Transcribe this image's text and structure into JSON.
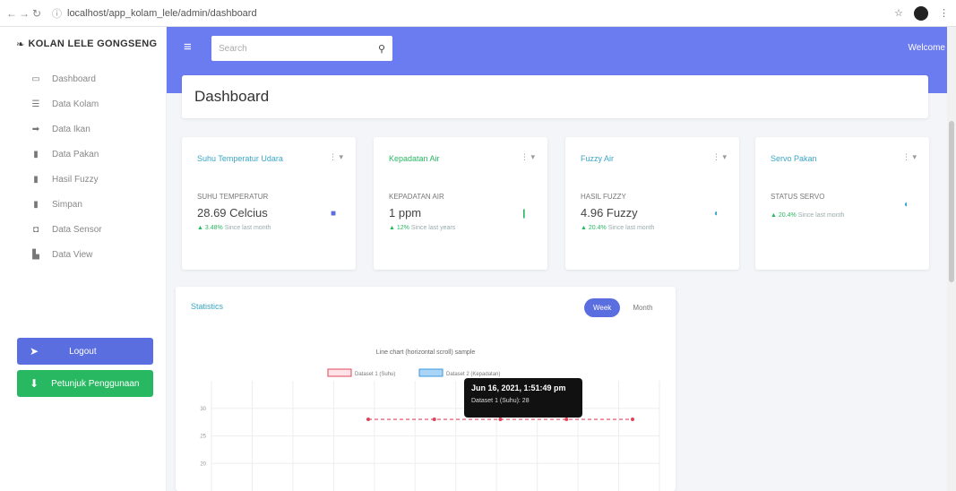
{
  "browser": {
    "url": "localhost/app_kolam_lele/admin/dashboard",
    "nav_back": "←",
    "nav_forward": "→",
    "nav_reload": "↻"
  },
  "sidebar": {
    "brand": "KOLAN LELE GONGSENG",
    "items": [
      {
        "label": "Dashboard",
        "icon": "monitor-icon",
        "glyph": "▭"
      },
      {
        "label": "Data Kolam",
        "icon": "table-icon",
        "glyph": "☰"
      },
      {
        "label": "Data Ikan",
        "icon": "fish-icon",
        "glyph": "➡"
      },
      {
        "label": "Data Pakan",
        "icon": "bag-icon",
        "glyph": "▮"
      },
      {
        "label": "Hasil Fuzzy",
        "icon": "document-icon",
        "glyph": "▮"
      },
      {
        "label": "Simpan",
        "icon": "save-icon",
        "glyph": "▮"
      },
      {
        "label": "Data Sensor",
        "icon": "sensor-icon",
        "glyph": "◘"
      },
      {
        "label": "Data View",
        "icon": "chart-icon",
        "glyph": "▙"
      }
    ],
    "logout_label": "Logout",
    "manual_label": "Petunjuk Penggunaan"
  },
  "topbar": {
    "search_placeholder": "Search",
    "welcome": "Welcome"
  },
  "page_title": "Dashboard",
  "cards": [
    {
      "title": "Suhu Temperatur Udara",
      "menu": "⋮ ▾",
      "label": "SUHU TEMPERATUR",
      "value": "28.69 Celcius",
      "trend_up": "▲ 3.48%",
      "trend_text": "Since last month",
      "icon_glyph": "■",
      "icon_color": "#5b6ee0",
      "icon": "temperature-icon"
    },
    {
      "title": "Kepadatan Air",
      "menu": "⋮ ▾",
      "label": "KEPADATAN AIR",
      "value": "1 ppm",
      "trend_up": "▲ 12%",
      "trend_text": "Since last years",
      "icon_glyph": "❙",
      "icon_color": "#28b862",
      "icon": "water-density-icon"
    },
    {
      "title": "Fuzzy Air",
      "menu": "⋮ ▾",
      "label": "HASIL FUZZY",
      "value": "4.96 Fuzzy",
      "trend_up": "▲ 20.4%",
      "trend_text": "Since last month",
      "icon_glyph": "◐",
      "icon_color": "#3aa6c7",
      "icon": "fuzzy-icon"
    },
    {
      "title": "Servo Pakan",
      "menu": "⋮ ▾",
      "label": "STATUS SERVO",
      "value": "",
      "trend_up": "▲ 20.4%",
      "trend_text": "Since last month",
      "icon_glyph": "◐",
      "icon_color": "#3aa6c7",
      "icon": "servo-icon"
    }
  ],
  "statistics": {
    "title": "Statistics",
    "toggle_active": "Week",
    "toggle_inactive": "Month",
    "tooltip_title": "Jun 16, 2021, 1:51:49 pm",
    "tooltip_body": "Dataset 1 (Suhu): 28"
  },
  "chart_data": {
    "type": "line",
    "title": "Line chart (horizontal scroll) sample",
    "legend": [
      "Dataset 1 (Suhu)",
      "Dataset 2 (Kepadatan)"
    ],
    "y_ticks": [
      "30",
      "25",
      "20"
    ],
    "ylim": [
      15,
      35
    ],
    "series": [
      {
        "name": "Dataset 1 (Suhu)",
        "color": "#e0445c",
        "values": [
          28,
          28,
          28,
          28,
          28
        ]
      }
    ]
  }
}
